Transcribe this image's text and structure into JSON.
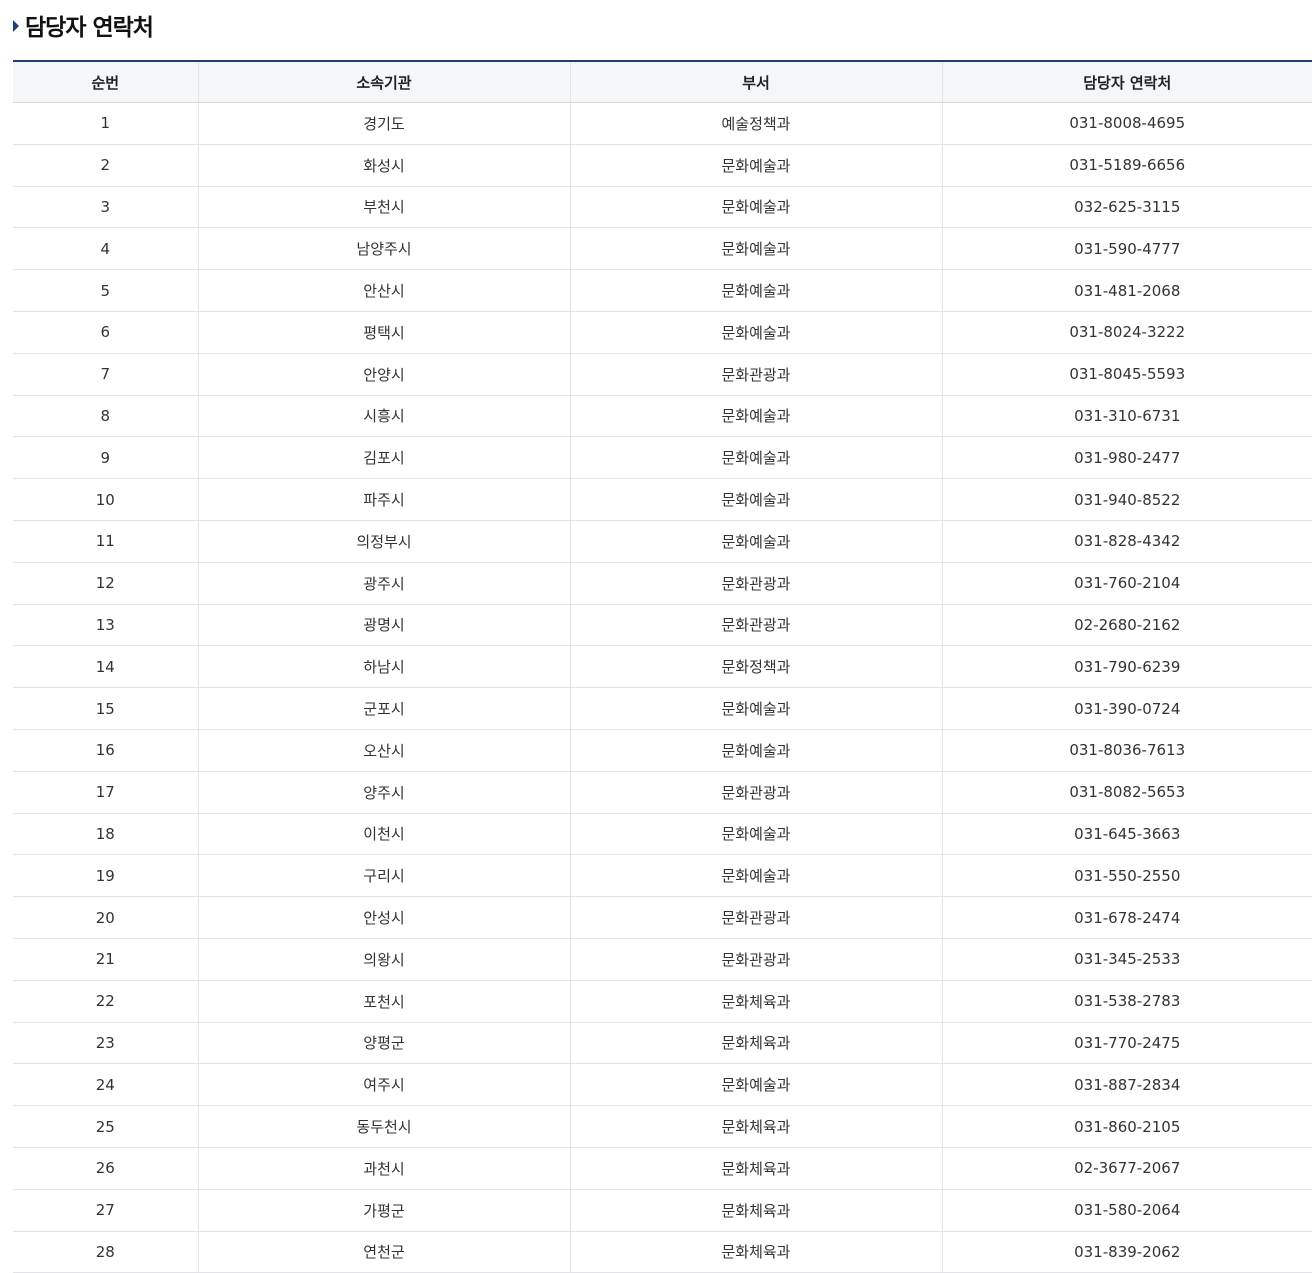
{
  "section": {
    "title": "담당자 연락처"
  },
  "table": {
    "headers": [
      "순번",
      "소속기관",
      "부서",
      "담당자 연락처"
    ],
    "rows": [
      [
        "1",
        "경기도",
        "예술정책과",
        "031-8008-4695"
      ],
      [
        "2",
        "화성시",
        "문화예술과",
        "031-5189-6656"
      ],
      [
        "3",
        "부천시",
        "문화예술과",
        "032-625-3115"
      ],
      [
        "4",
        "남양주시",
        "문화예술과",
        "031-590-4777"
      ],
      [
        "5",
        "안산시",
        "문화예술과",
        "031-481-2068"
      ],
      [
        "6",
        "평택시",
        "문화예술과",
        "031-8024-3222"
      ],
      [
        "7",
        "안양시",
        "문화관광과",
        "031-8045-5593"
      ],
      [
        "8",
        "시흥시",
        "문화예술과",
        "031-310-6731"
      ],
      [
        "9",
        "김포시",
        "문화예술과",
        "031-980-2477"
      ],
      [
        "10",
        "파주시",
        "문화예술과",
        "031-940-8522"
      ],
      [
        "11",
        "의정부시",
        "문화예술과",
        "031-828-4342"
      ],
      [
        "12",
        "광주시",
        "문화관광과",
        "031-760-2104"
      ],
      [
        "13",
        "광명시",
        "문화관광과",
        "02-2680-2162"
      ],
      [
        "14",
        "하남시",
        "문화정책과",
        "031-790-6239"
      ],
      [
        "15",
        "군포시",
        "문화예술과",
        "031-390-0724"
      ],
      [
        "16",
        "오산시",
        "문화예술과",
        "031-8036-7613"
      ],
      [
        "17",
        "양주시",
        "문화관광과",
        "031-8082-5653"
      ],
      [
        "18",
        "이천시",
        "문화예술과",
        "031-645-3663"
      ],
      [
        "19",
        "구리시",
        "문화예술과",
        "031-550-2550"
      ],
      [
        "20",
        "안성시",
        "문화관광과",
        "031-678-2474"
      ],
      [
        "21",
        "의왕시",
        "문화관광과",
        "031-345-2533"
      ],
      [
        "22",
        "포천시",
        "문화체육과",
        "031-538-2783"
      ],
      [
        "23",
        "양평군",
        "문화체육과",
        "031-770-2475"
      ],
      [
        "24",
        "여주시",
        "문화예술과",
        "031-887-2834"
      ],
      [
        "25",
        "동두천시",
        "문화체육과",
        "031-860-2105"
      ],
      [
        "26",
        "과천시",
        "문화체육과",
        "02-3677-2067"
      ],
      [
        "27",
        "가평군",
        "문화체육과",
        "031-580-2064"
      ],
      [
        "28",
        "연천군",
        "문화체육과",
        "031-839-2062"
      ]
    ]
  },
  "colors": {
    "accent": "#1f3f73",
    "header_bg": "#f5f6f8"
  }
}
